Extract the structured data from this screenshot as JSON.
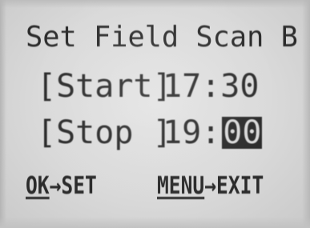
{
  "screen": {
    "title": "Set Field Scan B",
    "start_label": "[Start]",
    "start_time": "17:30",
    "stop_label": "[Stop ]",
    "stop_hour": "19:",
    "stop_minute": "00",
    "footer": {
      "ok_key": "OK",
      "ok_action": "→SET",
      "menu_key": "MENU",
      "menu_action": "→EXIT"
    }
  },
  "colors": {
    "lcd_background": "#d9d9d9",
    "lcd_text": "#2b2b2b"
  }
}
